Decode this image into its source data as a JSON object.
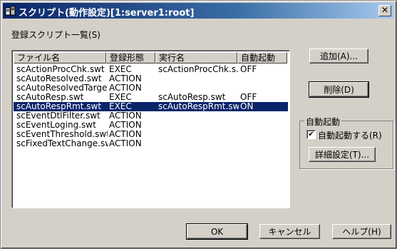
{
  "window": {
    "title": "スクリプト(動作設定)[1:server1:root]",
    "close_label": "✕"
  },
  "list_label": "登録スクリプト一覧(S)",
  "columns": [
    "ファイル名",
    "登録形態",
    "実行名",
    "自動起動"
  ],
  "rows": [
    {
      "file": "scActionProcChk.swt",
      "type": "EXEC",
      "exec": "scActionProcChk.s...",
      "auto": "OFF"
    },
    {
      "file": "scAutoResolved.swt",
      "type": "ACTION",
      "exec": "",
      "auto": ""
    },
    {
      "file": "scAutoResolvedTarget...",
      "type": "ACTION",
      "exec": "",
      "auto": ""
    },
    {
      "file": "scAutoResp.swt",
      "type": "EXEC",
      "exec": "scAutoResp.swt",
      "auto": "OFF"
    },
    {
      "file": "scAutoRespRmt.swt",
      "type": "EXEC",
      "exec": "scAutoRespRmt.swt",
      "auto": "ON"
    },
    {
      "file": "scEventDtlFilter.swt",
      "type": "ACTION",
      "exec": "",
      "auto": ""
    },
    {
      "file": "scEventLoging.swt",
      "type": "ACTION",
      "exec": "",
      "auto": ""
    },
    {
      "file": "scEventThreshold.swt",
      "type": "ACTION",
      "exec": "",
      "auto": ""
    },
    {
      "file": "scFixedTextChange.swt",
      "type": "ACTION",
      "exec": "",
      "auto": ""
    }
  ],
  "selected_row": 4,
  "buttons": {
    "add": "追加(A)...",
    "delete": "削除(D)",
    "detail": "詳細設定(T)...",
    "ok": "OK",
    "cancel": "キャンセル",
    "help": "ヘルプ(H)"
  },
  "autostart": {
    "group_label": "自動起動",
    "checkbox_label": "自動起動する(R)",
    "checked": true,
    "check_mark": "✔"
  }
}
